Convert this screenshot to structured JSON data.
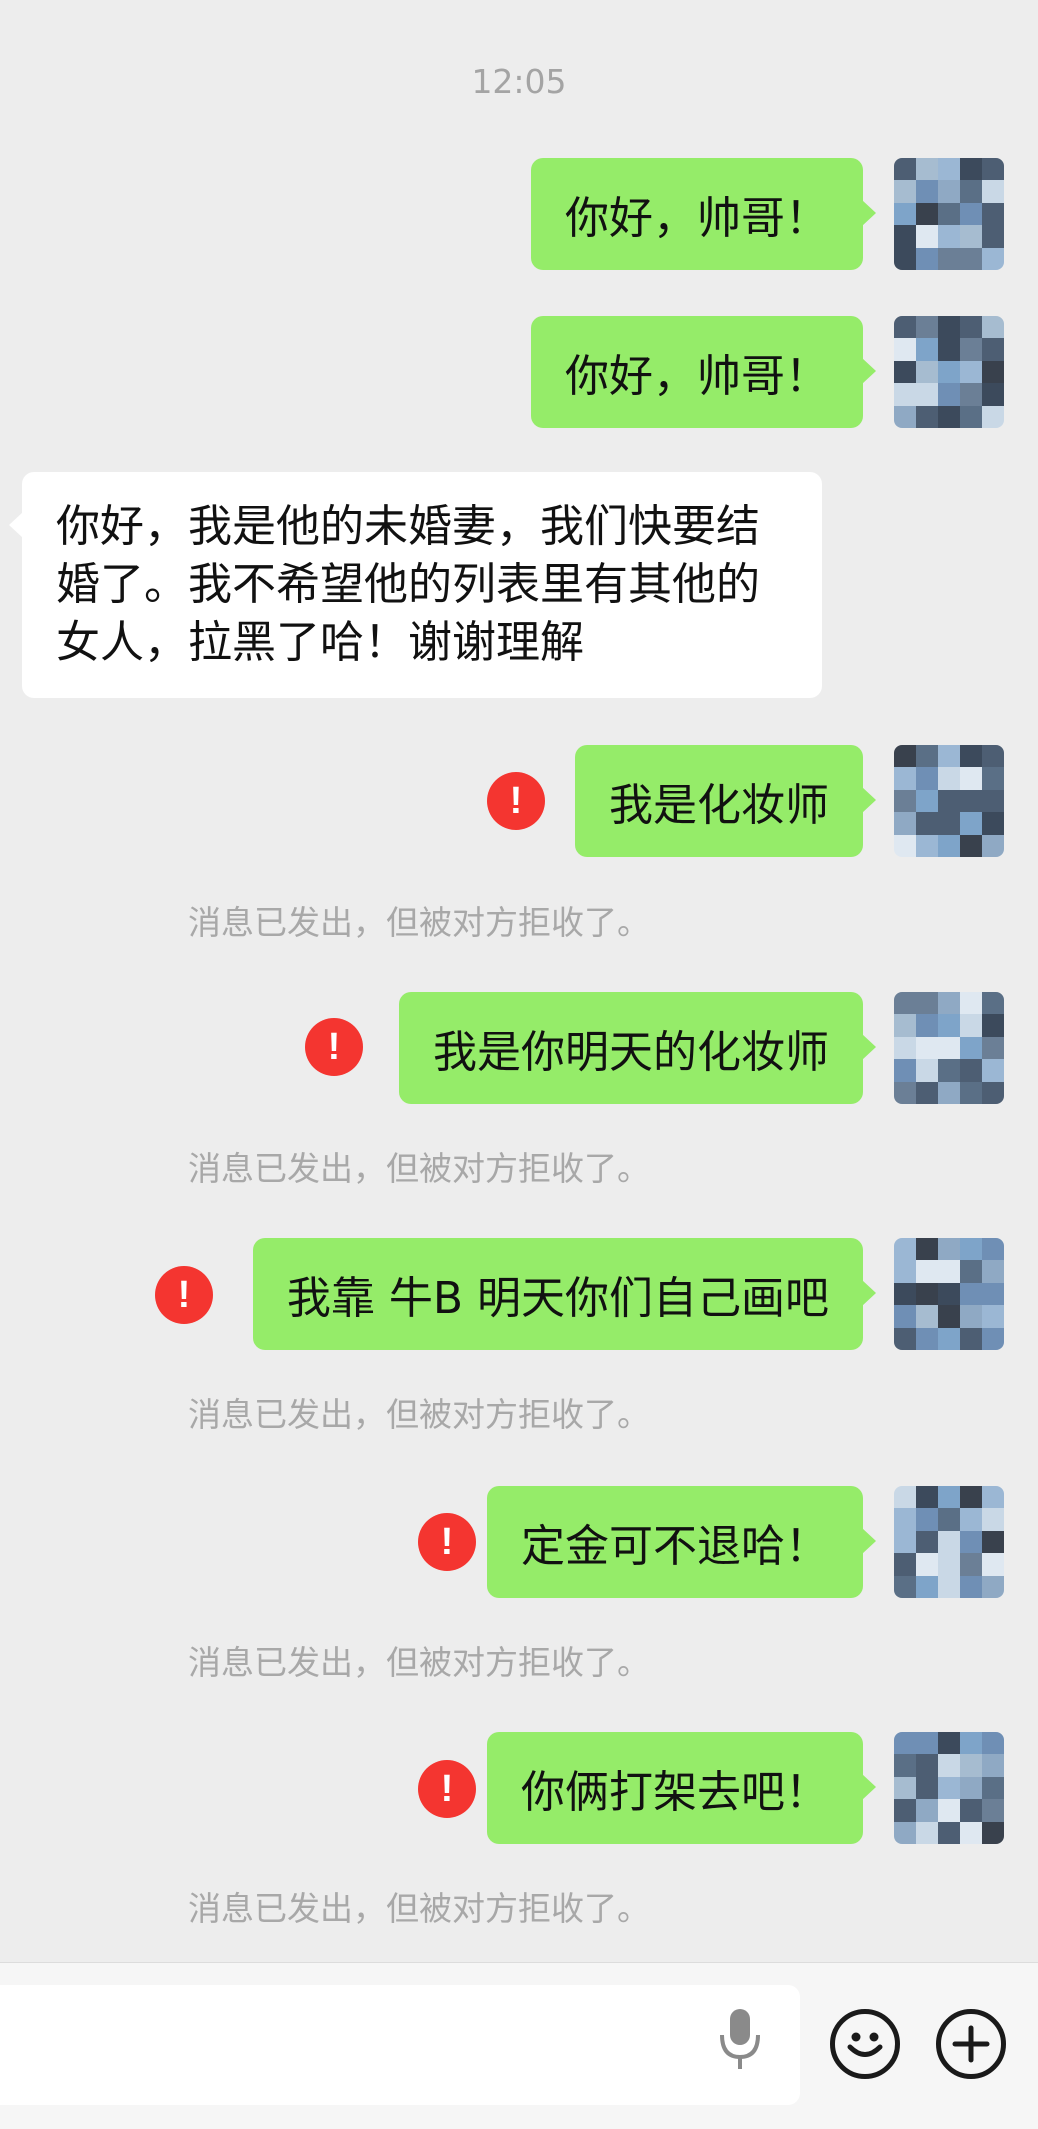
{
  "chat": {
    "time": "12:05",
    "messages": [
      {
        "text": "你好，帅哥！"
      },
      {
        "text": "你好，帅哥！"
      },
      {
        "lines": [
          "你好，我是他的未婚妻，我们快要结",
          "婚了。我不希望他的列表里有其他的",
          "女人，拉黑了哈！谢谢理解"
        ]
      },
      {
        "text": "我是化妆师",
        "error": "!",
        "status": "消息已发出，但被对方拒收了。"
      },
      {
        "text": "我是你明天的化妆师",
        "error": "!",
        "status": "消息已发出，但被对方拒收了。"
      },
      {
        "text": "我靠 牛B 明天你们自己画吧",
        "error": "!",
        "status": "消息已发出，但被对方拒收了。"
      },
      {
        "text": "定金可不退哈！",
        "error": "!",
        "status": "消息已发出，但被对方拒收了。"
      },
      {
        "text": "你俩打架去吧！",
        "error": "!",
        "status": "消息已发出，但被对方拒收了。"
      }
    ]
  },
  "input_bar": {
    "voice_icon": "microphone-icon",
    "emoji_icon": "smiley-face-icon",
    "more_icon": "plus-circle-icon"
  },
  "colors": {
    "background": "#ededed",
    "outgoing_bubble": "#95ec69",
    "incoming_bubble": "#ffffff",
    "error_badge": "#f43530",
    "status_text": "#a8a8a8"
  }
}
